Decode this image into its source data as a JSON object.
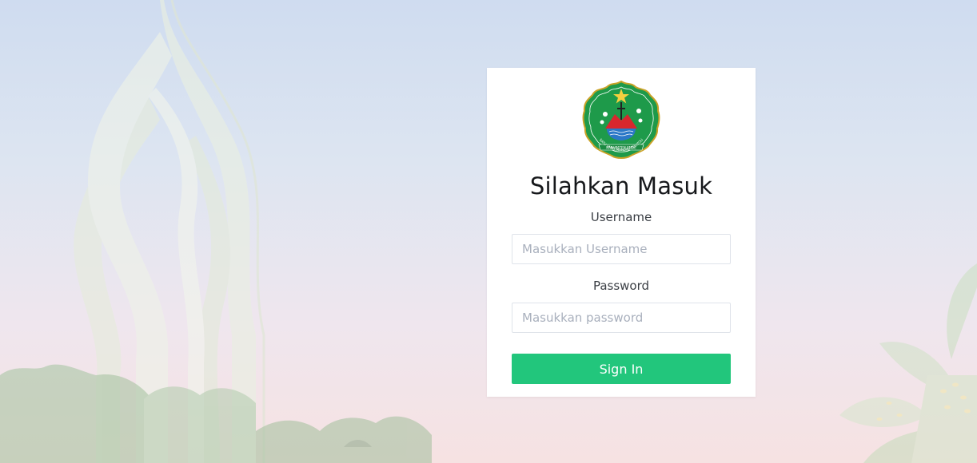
{
  "login": {
    "title": "Silahkan Masuk",
    "username_label": "Username",
    "username_placeholder": "Masukkan Username",
    "password_label": "Password",
    "password_placeholder": "Masukkan password",
    "signin_label": "Sign In"
  },
  "logo": {
    "arc_text": "SATU UMAT MANDIRI TOLITOLI",
    "ribbon_text": "KABUPATEN ENDE"
  },
  "colors": {
    "button": "#22c67c",
    "background_top": "#cfdcf0",
    "background_bottom": "#f6e2e2",
    "emblem_green": "#1e9a4a"
  },
  "icons": [
    "regional-emblem-logo",
    "monument-illustration",
    "tree-illustration",
    "leaf-illustration"
  ]
}
